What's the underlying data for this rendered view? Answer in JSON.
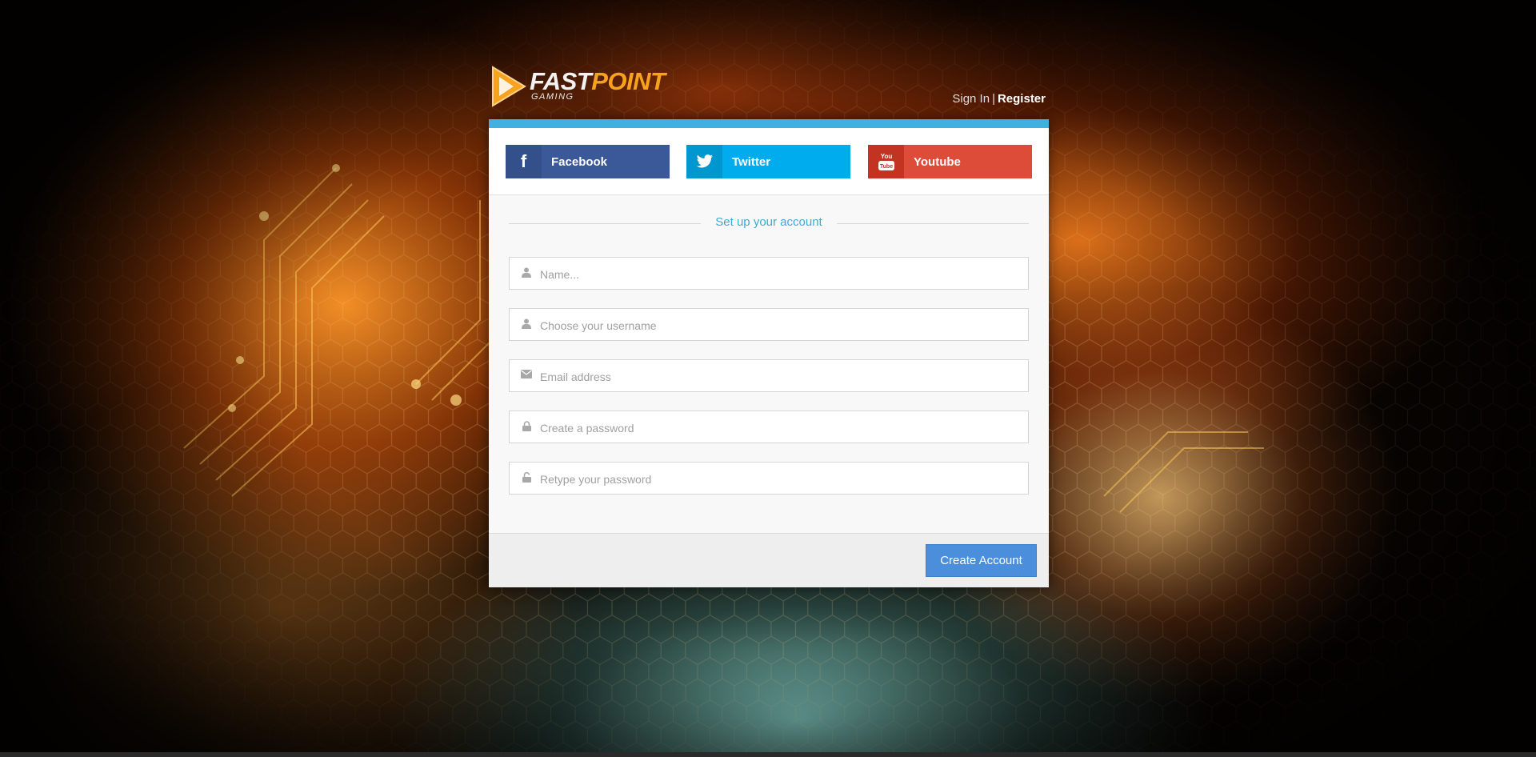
{
  "brand": {
    "name_part1": "FAST",
    "name_part2": "POINT",
    "subtitle": "GAMING",
    "accent_color": "#f7a21e"
  },
  "header": {
    "sign_in_label": "Sign In",
    "separator": "|",
    "register_label": "Register"
  },
  "social": [
    {
      "label": "Facebook",
      "icon": "facebook-icon",
      "color": "#3b5998"
    },
    {
      "label": "Twitter",
      "icon": "twitter-icon",
      "color": "#00aced"
    },
    {
      "label": "Youtube",
      "icon": "youtube-icon",
      "color": "#dd4b39"
    }
  ],
  "form": {
    "title": "Set up your account",
    "fields": [
      {
        "placeholder": "Name...",
        "value": "",
        "icon": "user-icon"
      },
      {
        "placeholder": "Choose your username",
        "value": "",
        "icon": "user-icon"
      },
      {
        "placeholder": "Email address",
        "value": "",
        "icon": "envelope-icon"
      },
      {
        "placeholder": "Create a password",
        "value": "",
        "icon": "lock-icon"
      },
      {
        "placeholder": "Retype your password",
        "value": "",
        "icon": "unlock-icon"
      }
    ],
    "submit_label": "Create Account"
  },
  "colors": {
    "panel_top_bar": "#3fb0e0",
    "title_text": "#3eaad7",
    "submit_button": "#4a8edc"
  }
}
